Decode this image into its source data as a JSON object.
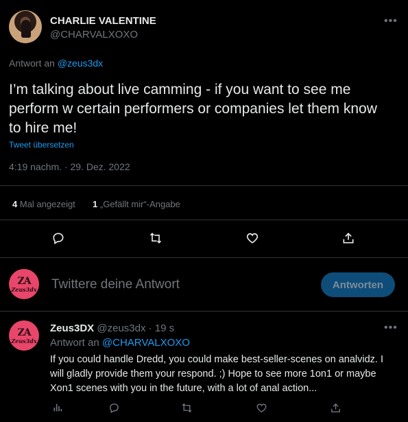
{
  "tweet": {
    "display_name": "CHARLIE VALENTINE",
    "handle": "@CHARVALXOXO",
    "reply_prefix": "Antwort an",
    "reply_to": "@zeus3dx",
    "text": "I’m talking about live camming - if you want to see me perform w certain performers or companies let them know to hire me!",
    "translate_label": "Tweet übersetzen",
    "timestamp": "4:19 nachm. · 29. Dez. 2022",
    "stats": {
      "views_count": "4",
      "views_label": "Mal angezeigt",
      "likes_count": "1",
      "likes_label": "„Gefällt mir“-Angabe"
    },
    "more_icon": "ellipsis-icon"
  },
  "action_bar": {
    "icons": [
      "reply-icon",
      "retweet-icon",
      "like-icon",
      "share-icon"
    ]
  },
  "composer": {
    "placeholder": "Twittere deine Antwort",
    "submit_label": "Antworten",
    "avatar_mark": "ZA",
    "avatar_word": "Zeus3dx"
  },
  "reply": {
    "display_name": "Zeus3DX",
    "handle": "@zeus3dx",
    "time": "19 s",
    "reply_prefix": "Antwort an",
    "reply_to": "@CHARVALXOXO",
    "text": "If you could handle Dredd, you could make best-seller-scenes on analvidz. I will gladly provide them your respond. ;) Hope to see more 1on1 or maybe Xon1 scenes with you in the future, with a lot of anal action...",
    "avatar_mark": "ZA",
    "avatar_word": "Zeus3dx",
    "icons": [
      "analytics-icon",
      "reply-icon",
      "retweet-icon",
      "like-icon",
      "share-icon"
    ]
  },
  "colors": {
    "background": "#000000",
    "text": "#e7e9ea",
    "muted": "#71767b",
    "accent": "#1d9bf0",
    "divider": "#2f3336",
    "avatar_pink": "#e8466a"
  }
}
